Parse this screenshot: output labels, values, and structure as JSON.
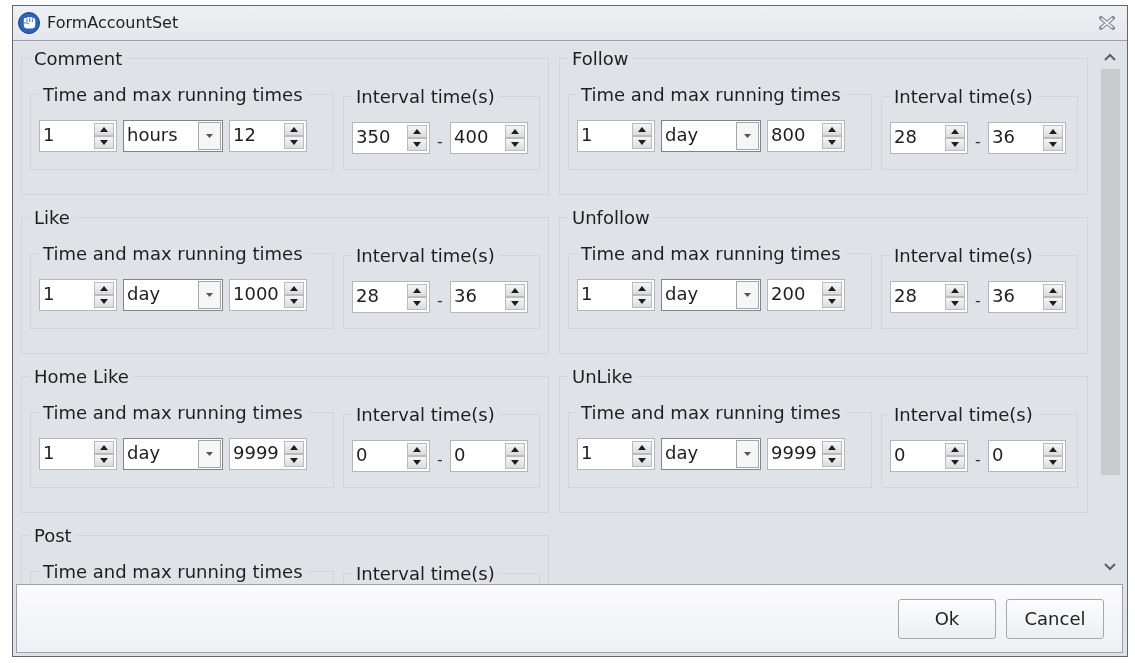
{
  "window": {
    "title": "FormAccountSet"
  },
  "groups": [
    {
      "title": "Comment",
      "schedule": {
        "label": "Time and max running times",
        "count": "1",
        "unit": "hours",
        "max": "12"
      },
      "interval": {
        "label": "Interval time(s)",
        "min": "350",
        "separator": "-",
        "max": "400"
      }
    },
    {
      "title": "Follow",
      "schedule": {
        "label": "Time and max running times",
        "count": "1",
        "unit": "day",
        "max": "800"
      },
      "interval": {
        "label": "Interval time(s)",
        "min": "28",
        "separator": "-",
        "max": "36"
      }
    },
    {
      "title": "Like",
      "schedule": {
        "label": "Time and max running times",
        "count": "1",
        "unit": "day",
        "max": "1000"
      },
      "interval": {
        "label": "Interval time(s)",
        "min": "28",
        "separator": "-",
        "max": "36"
      }
    },
    {
      "title": "Unfollow",
      "schedule": {
        "label": "Time and max running times",
        "count": "1",
        "unit": "day",
        "max": "200"
      },
      "interval": {
        "label": "Interval time(s)",
        "min": "28",
        "separator": "-",
        "max": "36"
      }
    },
    {
      "title": "Home Like",
      "schedule": {
        "label": "Time and max running times",
        "count": "1",
        "unit": "day",
        "max": "9999"
      },
      "interval": {
        "label": "Interval time(s)",
        "min": "0",
        "separator": "-",
        "max": "0"
      }
    },
    {
      "title": "UnLike",
      "schedule": {
        "label": "Time and max running times",
        "count": "1",
        "unit": "day",
        "max": "9999"
      },
      "interval": {
        "label": "Interval time(s)",
        "min": "0",
        "separator": "-",
        "max": "0"
      }
    },
    {
      "title": "Post",
      "schedule": {
        "label": "Time and max running times"
      },
      "interval": {
        "label": "Interval time(s)"
      }
    }
  ],
  "buttons": [
    "Ok",
    "Cancel"
  ]
}
